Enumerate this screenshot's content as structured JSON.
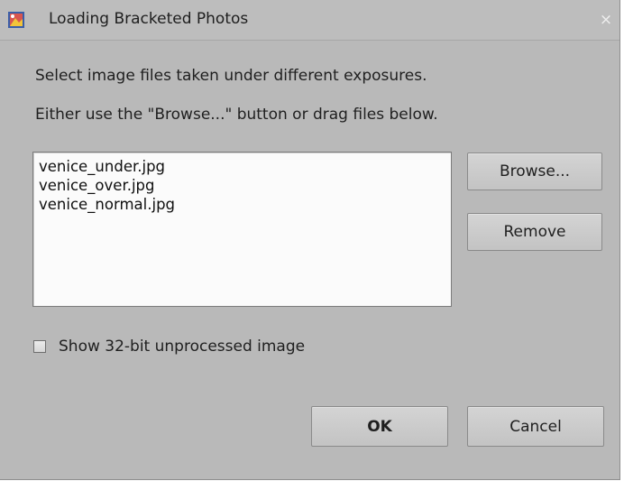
{
  "window": {
    "title": "Loading Bracketed Photos",
    "close_glyph": "×"
  },
  "instructions": {
    "line1": "Select image files taken under different exposures.",
    "line2": "Either use the \"Browse...\" button or drag files below."
  },
  "file_list": {
    "items": [
      "venice_under.jpg",
      "venice_over.jpg",
      "venice_normal.jpg"
    ]
  },
  "buttons": {
    "browse": "Browse...",
    "remove": "Remove",
    "ok": "OK",
    "cancel": "Cancel"
  },
  "options": {
    "show_32bit_label": "Show 32-bit unprocessed image",
    "show_32bit_checked": false
  },
  "icons": {
    "app": "photoshop-elements-app-icon",
    "close": "close-icon"
  }
}
